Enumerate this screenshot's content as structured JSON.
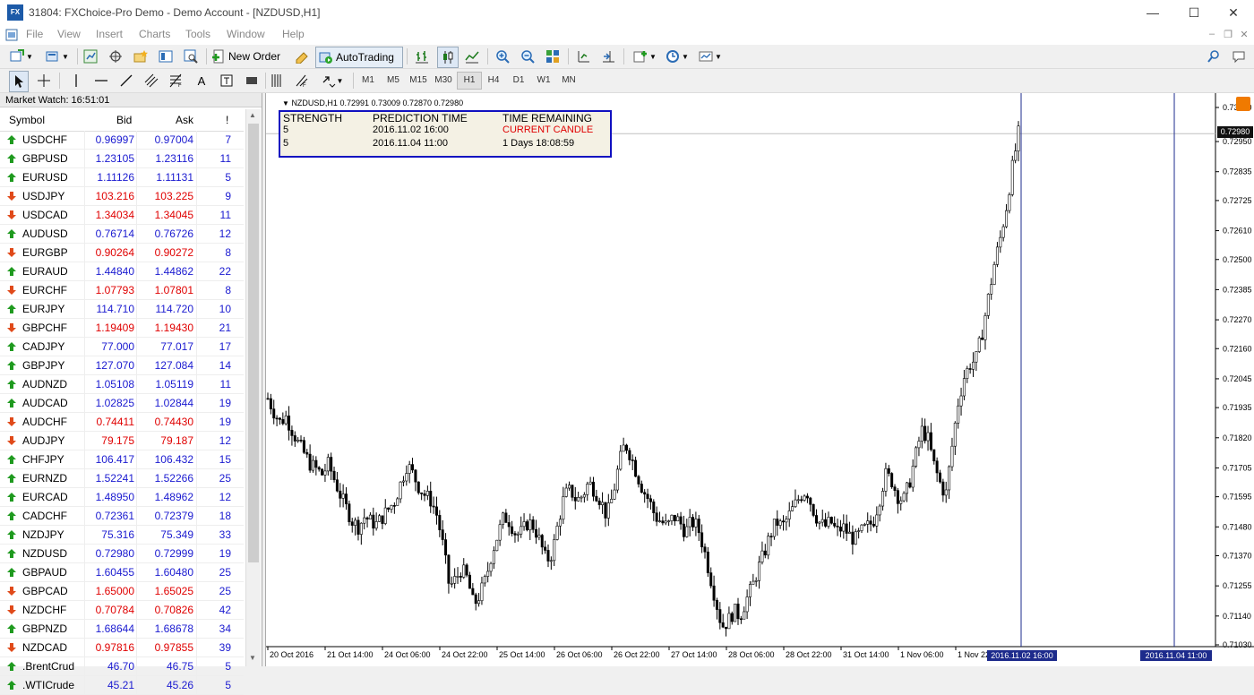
{
  "window": {
    "title": "31804: FXChoice-Pro Demo - Demo Account - [NZDUSD,H1]",
    "app_icon_text": "FX",
    "minimize": "—",
    "maximize": "☐",
    "close": "✕"
  },
  "menu": [
    "File",
    "View",
    "Insert",
    "Charts",
    "Tools",
    "Window",
    "Help"
  ],
  "toolbar": {
    "new_order": "New Order",
    "auto_trading": "AutoTrading",
    "timeframes": [
      "M1",
      "M5",
      "M15",
      "M30",
      "H1",
      "H4",
      "D1",
      "W1",
      "MN"
    ],
    "active_timeframe": "H1",
    "text_tool": "A"
  },
  "market_watch": {
    "header": "Market Watch: 16:51:01",
    "columns": {
      "symbol": "Symbol",
      "bid": "Bid",
      "ask": "Ask",
      "spread": "!"
    },
    "rows": [
      {
        "symbol": "USDCHF",
        "bid": "0.96997",
        "ask": "0.97004",
        "spread": "7",
        "dir": "up"
      },
      {
        "symbol": "GBPUSD",
        "bid": "1.23105",
        "ask": "1.23116",
        "spread": "11",
        "dir": "up"
      },
      {
        "symbol": "EURUSD",
        "bid": "1.11126",
        "ask": "1.11131",
        "spread": "5",
        "dir": "up"
      },
      {
        "symbol": "USDJPY",
        "bid": "103.216",
        "ask": "103.225",
        "spread": "9",
        "dir": "down"
      },
      {
        "symbol": "USDCAD",
        "bid": "1.34034",
        "ask": "1.34045",
        "spread": "11",
        "dir": "down"
      },
      {
        "symbol": "AUDUSD",
        "bid": "0.76714",
        "ask": "0.76726",
        "spread": "12",
        "dir": "up"
      },
      {
        "symbol": "EURGBP",
        "bid": "0.90264",
        "ask": "0.90272",
        "spread": "8",
        "dir": "down"
      },
      {
        "symbol": "EURAUD",
        "bid": "1.44840",
        "ask": "1.44862",
        "spread": "22",
        "dir": "up"
      },
      {
        "symbol": "EURCHF",
        "bid": "1.07793",
        "ask": "1.07801",
        "spread": "8",
        "dir": "down"
      },
      {
        "symbol": "EURJPY",
        "bid": "114.710",
        "ask": "114.720",
        "spread": "10",
        "dir": "up"
      },
      {
        "symbol": "GBPCHF",
        "bid": "1.19409",
        "ask": "1.19430",
        "spread": "21",
        "dir": "down"
      },
      {
        "symbol": "CADJPY",
        "bid": "77.000",
        "ask": "77.017",
        "spread": "17",
        "dir": "up"
      },
      {
        "symbol": "GBPJPY",
        "bid": "127.070",
        "ask": "127.084",
        "spread": "14",
        "dir": "up"
      },
      {
        "symbol": "AUDNZD",
        "bid": "1.05108",
        "ask": "1.05119",
        "spread": "11",
        "dir": "up"
      },
      {
        "symbol": "AUDCAD",
        "bid": "1.02825",
        "ask": "1.02844",
        "spread": "19",
        "dir": "up"
      },
      {
        "symbol": "AUDCHF",
        "bid": "0.74411",
        "ask": "0.74430",
        "spread": "19",
        "dir": "down"
      },
      {
        "symbol": "AUDJPY",
        "bid": "79.175",
        "ask": "79.187",
        "spread": "12",
        "dir": "down"
      },
      {
        "symbol": "CHFJPY",
        "bid": "106.417",
        "ask": "106.432",
        "spread": "15",
        "dir": "up"
      },
      {
        "symbol": "EURNZD",
        "bid": "1.52241",
        "ask": "1.52266",
        "spread": "25",
        "dir": "up"
      },
      {
        "symbol": "EURCAD",
        "bid": "1.48950",
        "ask": "1.48962",
        "spread": "12",
        "dir": "up"
      },
      {
        "symbol": "CADCHF",
        "bid": "0.72361",
        "ask": "0.72379",
        "spread": "18",
        "dir": "up"
      },
      {
        "symbol": "NZDJPY",
        "bid": "75.316",
        "ask": "75.349",
        "spread": "33",
        "dir": "up"
      },
      {
        "symbol": "NZDUSD",
        "bid": "0.72980",
        "ask": "0.72999",
        "spread": "19",
        "dir": "up"
      },
      {
        "symbol": "GBPAUD",
        "bid": "1.60455",
        "ask": "1.60480",
        "spread": "25",
        "dir": "up"
      },
      {
        "symbol": "GBPCAD",
        "bid": "1.65000",
        "ask": "1.65025",
        "spread": "25",
        "dir": "down"
      },
      {
        "symbol": "NZDCHF",
        "bid": "0.70784",
        "ask": "0.70826",
        "spread": "42",
        "dir": "down"
      },
      {
        "symbol": "GBPNZD",
        "bid": "1.68644",
        "ask": "1.68678",
        "spread": "34",
        "dir": "up"
      },
      {
        "symbol": "NZDCAD",
        "bid": "0.97816",
        "ask": "0.97855",
        "spread": "39",
        "dir": "down"
      },
      {
        "symbol": ".BrentCrud",
        "bid": "46.70",
        "ask": "46.75",
        "spread": "5",
        "dir": "up"
      },
      {
        "symbol": ".WTICrude",
        "bid": "45.21",
        "ask": "45.26",
        "spread": "5",
        "dir": "up"
      }
    ]
  },
  "chart": {
    "info": "NZDUSD,H1  0.72991 0.73009 0.72870 0.72980",
    "prediction": {
      "headers": [
        "STRENGTH",
        "PREDICTION TIME",
        "TIME REMAINING"
      ],
      "rows": [
        {
          "strength": "5",
          "time": "2016.11.02 16:00",
          "remaining": "CURRENT CANDLE"
        },
        {
          "strength": "5",
          "time": "2016.11.04 11:00",
          "remaining": "1 Days 18:08:59"
        }
      ]
    },
    "current_price": "0.72980",
    "vline_tags": [
      "2016.11.02 16:00",
      "2016.11.04 11:00"
    ],
    "colors": {
      "up": "#1a1ad0",
      "down": "#e00000",
      "vline": "#1d2b8c",
      "candle": "#000000"
    }
  },
  "chart_data": {
    "type": "candlestick",
    "symbol": "NZDUSD",
    "timeframe": "H1",
    "y_ticks": [
      "0.73080",
      "0.72950",
      "0.72835",
      "0.72725",
      "0.72610",
      "0.72500",
      "0.72385",
      "0.72270",
      "0.72160",
      "0.72045",
      "0.71935",
      "0.71820",
      "0.71705",
      "0.71595",
      "0.71480",
      "0.71370",
      "0.71255",
      "0.71140",
      "0.71030"
    ],
    "x_ticks": [
      "20 Oct 2016",
      "21 Oct 14:00",
      "24 Oct 06:00",
      "24 Oct 22:00",
      "25 Oct 14:00",
      "26 Oct 06:00",
      "26 Oct 22:00",
      "27 Oct 14:00",
      "28 Oct 06:00",
      "28 Oct 22:00",
      "31 Oct 14:00",
      "1 Nov 06:00",
      "1 Nov 22:00"
    ],
    "ylim": [
      0.7103,
      0.7308
    ],
    "close_path": [
      0.7197,
      0.7192,
      0.7188,
      0.719,
      0.7185,
      0.718,
      0.7176,
      0.7172,
      0.717,
      0.7168,
      0.7172,
      0.7166,
      0.716,
      0.7155,
      0.715,
      0.7148,
      0.7152,
      0.715,
      0.7149,
      0.7152,
      0.7155,
      0.7158,
      0.7165,
      0.7172,
      0.7168,
      0.7163,
      0.716,
      0.7158,
      0.7152,
      0.714,
      0.7125,
      0.7128,
      0.7132,
      0.7128,
      0.7118,
      0.7122,
      0.7128,
      0.7138,
      0.7145,
      0.7152,
      0.715,
      0.7145,
      0.7146,
      0.715,
      0.7148,
      0.7142,
      0.7135,
      0.7138,
      0.715,
      0.716,
      0.7162,
      0.7158,
      0.716,
      0.7165,
      0.7162,
      0.7158,
      0.7152,
      0.716,
      0.7172,
      0.718,
      0.7175,
      0.7168,
      0.7162,
      0.7158,
      0.7152,
      0.715,
      0.7148,
      0.7152,
      0.715,
      0.7146,
      0.715,
      0.7148,
      0.714,
      0.713,
      0.712,
      0.711,
      0.7112,
      0.7116,
      0.7114,
      0.712,
      0.7125,
      0.7132,
      0.7138,
      0.7145,
      0.715,
      0.7148,
      0.7152,
      0.7156,
      0.716,
      0.7162,
      0.7155,
      0.715,
      0.7148,
      0.715,
      0.7146,
      0.7148,
      0.7145,
      0.7143,
      0.7146,
      0.7148,
      0.715,
      0.7158,
      0.7168,
      0.7166,
      0.716,
      0.7158,
      0.7165,
      0.7175,
      0.7185,
      0.7182,
      0.7172,
      0.7165,
      0.716,
      0.7178,
      0.7195,
      0.7205,
      0.721,
      0.7212,
      0.7222,
      0.7235,
      0.7248,
      0.7258,
      0.727,
      0.7285,
      0.7298
    ],
    "series": [
      {
        "name": "NZDUSD,H1"
      }
    ],
    "current_price": 0.7298
  }
}
